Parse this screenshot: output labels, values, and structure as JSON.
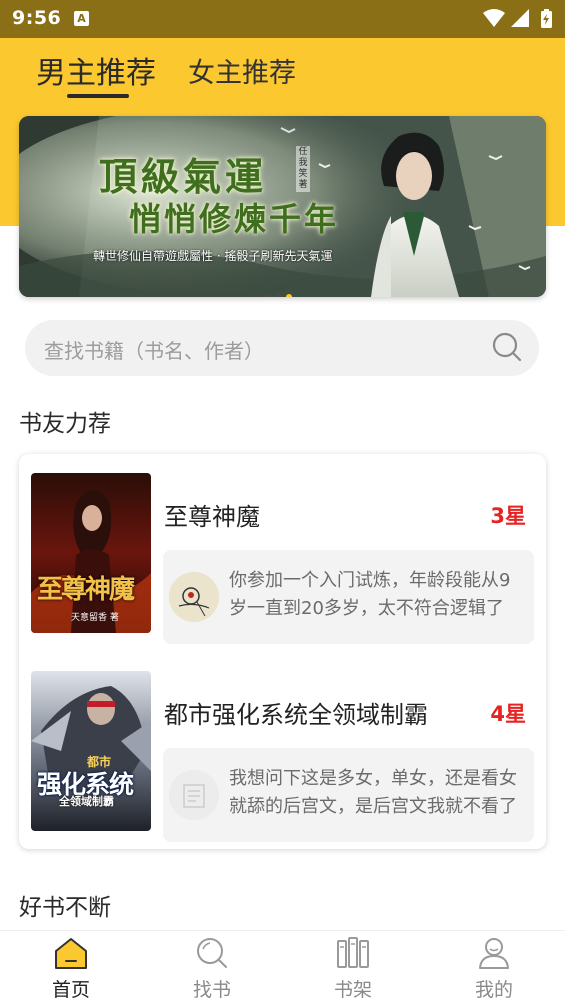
{
  "status_bar": {
    "time": "9:56",
    "notification_glyph": "A"
  },
  "tabs": [
    {
      "label": "男主推荐",
      "active": true
    },
    {
      "label": "女主推荐",
      "active": false
    }
  ],
  "banner": {
    "title_line1": "頂級氣運",
    "title_line2": "悄悄修煉千年",
    "author": "任我笑著",
    "subtitle": "轉世修仙自帶遊戲屬性 · 搖骰子刷新先天氣運",
    "slide_count": 3,
    "active_slide": 3
  },
  "search": {
    "placeholder": "查找书籍（书名、作者）",
    "icon": "search-icon"
  },
  "section_recommend": {
    "title": "书友力荐"
  },
  "books": [
    {
      "title": "至尊神魔",
      "rating": "3星",
      "cover_text": "至尊神魔",
      "cover_author": "天意留香 著",
      "review": "你参加一个入门试炼，年龄段能从9岁一直到20多岁，太不符合逻辑了"
    },
    {
      "title": "都市强化系统全领域制霸",
      "rating": "4星",
      "cover_text_top": "都市",
      "cover_text": "强化系统",
      "cover_text_sub": "全领域制霸",
      "review": "我想问下这是多女，单女，还是看女就舔的后宫文，是后宫文我就不看了"
    }
  ],
  "section_more": {
    "title": "好书不断"
  },
  "bottom_nav": [
    {
      "label": "首页",
      "icon": "home-icon",
      "active": true
    },
    {
      "label": "找书",
      "icon": "search-icon",
      "active": false
    },
    {
      "label": "书架",
      "icon": "bookshelf-icon",
      "active": false
    },
    {
      "label": "我的",
      "icon": "user-icon",
      "active": false
    }
  ],
  "colors": {
    "accent": "#fbc82f",
    "rating": "#e62222",
    "status_bar": "#8a6f16"
  }
}
